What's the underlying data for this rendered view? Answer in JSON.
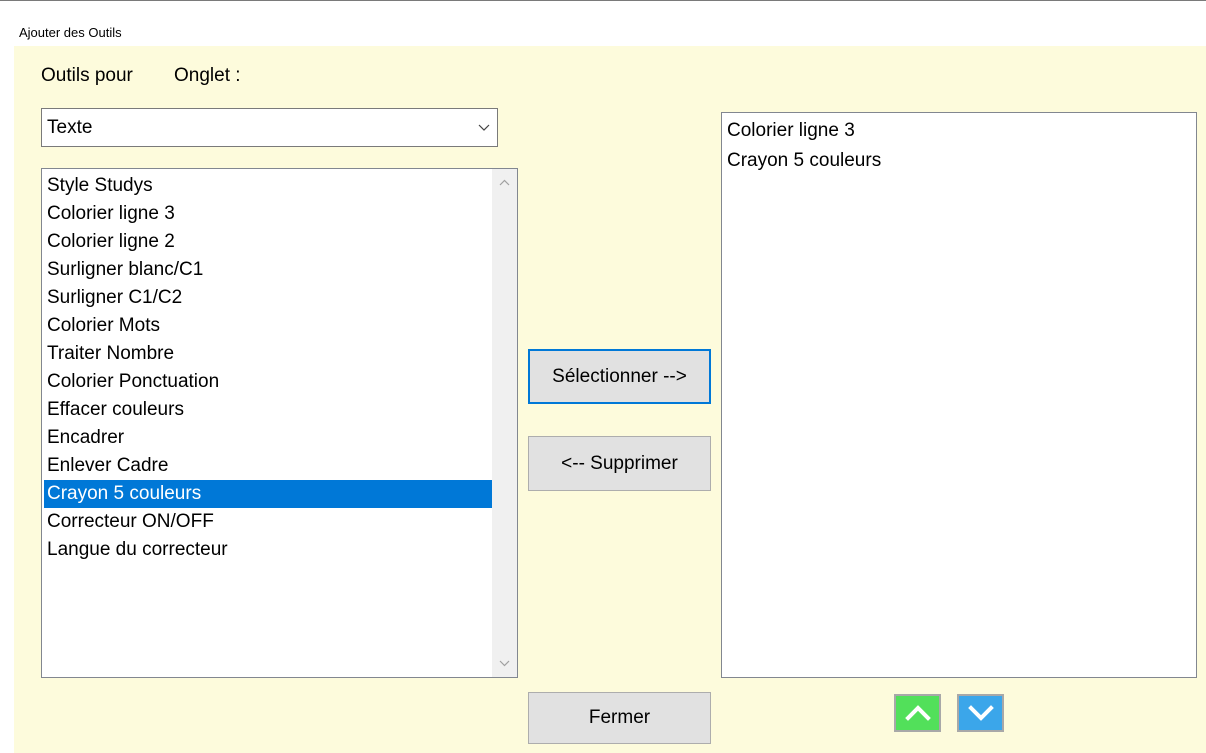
{
  "window": {
    "title": "Ajouter des Outils"
  },
  "labels": {
    "outils_pour": "Outils pour",
    "onglet": "Onglet :"
  },
  "combo": {
    "value": "Texte",
    "icon": "chevron-down-icon"
  },
  "available_tools": {
    "items": [
      "Style Studys",
      "Colorier ligne 3",
      "Colorier ligne 2",
      "Surligner blanc/C1",
      "Surligner C1/C2",
      "Colorier Mots",
      "Traiter Nombre",
      "Colorier Ponctuation",
      "Effacer couleurs",
      "Encadrer",
      "Enlever Cadre",
      "Crayon 5 couleurs",
      "Correcteur ON/OFF",
      "Langue du correcteur"
    ],
    "selected": "Crayon 5 couleurs"
  },
  "selected_tools": {
    "items": [
      "Colorier ligne 3",
      "Crayon 5 couleurs"
    ]
  },
  "buttons": {
    "select": "Sélectionner -->",
    "remove": "<-- Supprimer",
    "close": "Fermer"
  },
  "move_buttons": {
    "up": {
      "icon": "chevron-up-icon",
      "color": "#52e05a"
    },
    "down": {
      "icon": "chevron-down-icon",
      "color": "#3ba6ea"
    }
  },
  "colors": {
    "background": "#fdfbdc",
    "selection": "#0078d7",
    "focus_border": "#0078d7"
  }
}
